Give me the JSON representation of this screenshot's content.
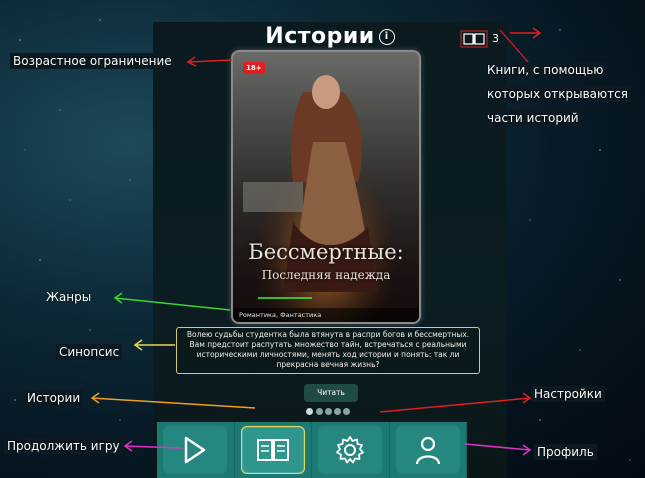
{
  "header": {
    "title": "Истории",
    "info_icon": "info-circle-icon",
    "books_icon": "open-book-icon",
    "books_count": "3"
  },
  "story": {
    "age_rating": "18+",
    "cover_title": "Бессмертные:",
    "cover_subtitle": "Последняя надежда",
    "genres": "Романтика, Фантастика",
    "synopsis": "Волею судьбы студентка была втянута в распри богов и бессмертных. Вам предстоит распутать множество тайн, встречаться с реальными историческими личностями, менять ход истории и понять: так ли прекрасна вечная жизнь?",
    "read_label": "Читать"
  },
  "pager": {
    "count": 5,
    "active": 0
  },
  "nav": {
    "items": [
      {
        "name": "continue",
        "icon": "play-icon"
      },
      {
        "name": "stories",
        "icon": "book-icon",
        "active": true
      },
      {
        "name": "settings",
        "icon": "gear-icon"
      },
      {
        "name": "profile",
        "icon": "user-icon"
      }
    ]
  },
  "annotations": {
    "age_restriction": "Возрастное ограничение",
    "books": [
      "Книги, с помощью",
      "которых открываются",
      "части историй"
    ],
    "genres": "Жанры",
    "synopsis": "Синопсис",
    "stories": "Истории",
    "continue_game": "Продолжить игру",
    "settings": "Настройки",
    "profile": "Профиль"
  },
  "colors": {
    "accent_teal": "#1c7a72",
    "badge_red": "#e02020",
    "synopsis_border": "#d7c77a",
    "arrow_red": "#e0201c",
    "arrow_green": "#3cd430",
    "arrow_yellow": "#e8d85a",
    "arrow_orange": "#f0a020",
    "arrow_magenta": "#e030c8"
  }
}
